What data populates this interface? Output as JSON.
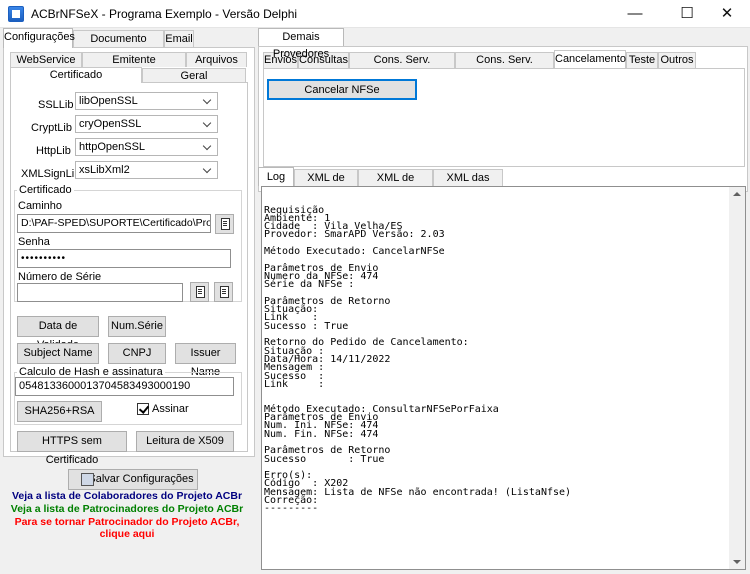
{
  "window": {
    "title": "ACBrNFSeX - Programa Exemplo - Versão Delphi",
    "minimize": "—",
    "maximize": "☐",
    "close": "✕"
  },
  "left_tabs": [
    "Configurações",
    "Documento Auxiliar",
    "Email"
  ],
  "config_tabs_row1": [
    "WebService",
    "Emitente",
    "Arquivos"
  ],
  "config_tabs_row2": [
    "Certificado",
    "Geral"
  ],
  "libs": [
    {
      "label": "SSLLib",
      "value": "libOpenSSL"
    },
    {
      "label": "CryptLib",
      "value": "cryOpenSSL"
    },
    {
      "label": "HttpLib",
      "value": "httpOpenSSL"
    },
    {
      "label": "XMLSignLib",
      "value": "xsLibXml2"
    }
  ],
  "certificado": {
    "group_title": "Certificado",
    "caminho_label": "Caminho",
    "caminho_value": "D:\\PAF-SPED\\SUPORTE\\Certificado\\ProContr",
    "senha_label": "Senha",
    "senha_value": "••••••••••",
    "serie_label": "Número de Série",
    "serie_value": ""
  },
  "buttons": {
    "data_validade": "Data de Validade",
    "num_serie": "Num.Série",
    "subject_name": "Subject Name",
    "cnpj": "CNPJ",
    "issuer_name": "Issuer Name",
    "sha256": "SHA256+RSA",
    "https": "HTTPS sem Certificado",
    "leitura": "Leitura de X509",
    "salvar": "Salvar Configurações",
    "cancelar_nfse": "Cancelar NFSe"
  },
  "hash": {
    "group_title": "Calculo de Hash e assinatura",
    "value": "0548133600013704583493000190",
    "assinar_label": "Assinar"
  },
  "links": {
    "colaboradores": "Veja a lista de Colaboradores do Projeto ACBr",
    "patrocinadores": "Veja a lista de Patrocinadores do Projeto ACBr",
    "patrocinador_1": "Para se tornar Patrocinador do Projeto ACBr,",
    "patrocinador_2": "clique aqui",
    "colors": {
      "blue": "#000080",
      "green": "#008000",
      "red": "#ff0000"
    }
  },
  "right_top_tab": "Demais Provedores",
  "provider_tabs": [
    "Envios",
    "Consultas",
    "Cons. Serv. Prestados",
    "Cons. Serv. Tomados",
    "Cancelamento",
    "Teste",
    "Outros"
  ],
  "log_tabs": [
    "Log",
    "XML de Envio",
    "XML de Retorno",
    "XML das Notas"
  ],
  "log_lines": [
    "Requisição",
    "Ambiente: 1",
    "Cidade  : Vila Velha/ES",
    "Provedor: SmarAPD Versão: 2.03",
    "",
    "Método Executado: CancelarNFSe",
    "",
    "Parâmetros de Envio",
    "Numero da NFSe: 474",
    "Série da NFSe :",
    "",
    "Parâmetros de Retorno",
    "Situação:",
    "Link    :",
    "Sucesso : True",
    "",
    "Retorno do Pedido de Cancelamento:",
    "Situação :",
    "Data/Hora: 14/11/2022",
    "Mensagem :",
    "Sucesso  :",
    "Link     :",
    "",
    "",
    "Método Executado: ConsultarNFSePorFaixa",
    "Parâmetros de Envio",
    "Num. Ini. NFSe: 474",
    "Num. Fin. NFSe: 474",
    "",
    "Parâmetros de Retorno",
    "Sucesso       : True",
    "",
    "Erro(s):",
    "Código  : X202",
    "Mensagem: Lista de NFSe não encontrada! (ListaNfse)",
    "Correção:",
    "---------"
  ]
}
